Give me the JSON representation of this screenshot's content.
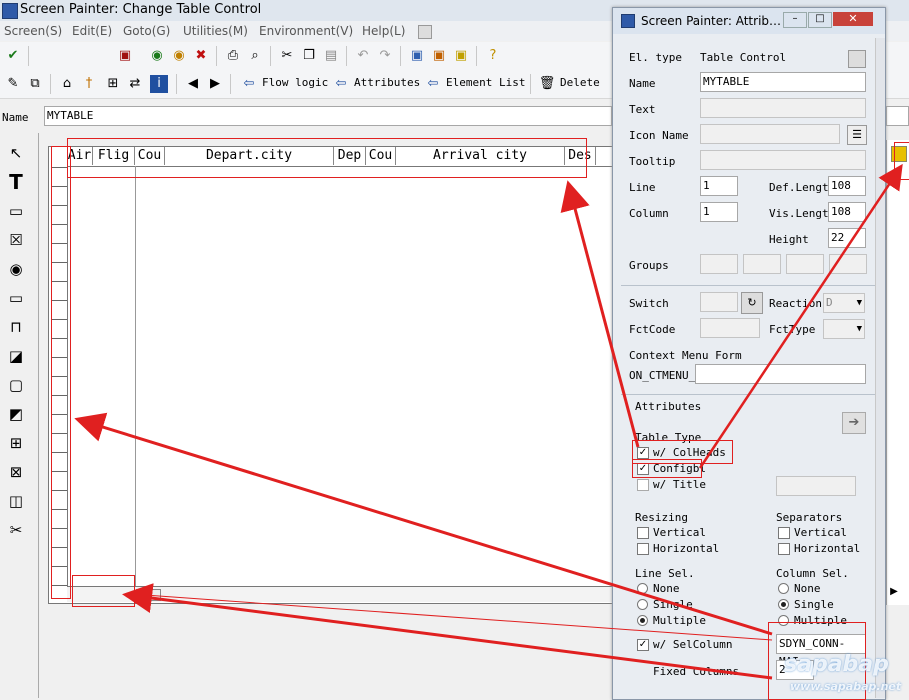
{
  "window": {
    "title": "Screen Painter: Change Table Control"
  },
  "menu": [
    "Screen(S)",
    "Edit(E)",
    "Goto(G)",
    "Utilities(M)",
    "Environment(V)",
    "Help(L)"
  ],
  "toolbar2": {
    "flow_logic": "Flow logic",
    "attributes": "Attributes",
    "element_list": "Element List",
    "delete": "Delete"
  },
  "name_row": {
    "label": "Name",
    "value": "MYTABLE"
  },
  "table": {
    "columns": [
      "Air",
      "Flig",
      "Cou",
      "Depart.city",
      "Dep",
      "Cou",
      "Arrival city",
      "Des"
    ]
  },
  "dialog": {
    "title": "Screen Painter: Attrib…",
    "el_type_label": "El. type",
    "el_type_value": "Table Control",
    "name_label": "Name",
    "name_value": "MYTABLE",
    "text_label": "Text",
    "icon_name_label": "Icon Name",
    "tooltip_label": "Tooltip",
    "line_label": "Line",
    "line_value": "1",
    "column_label": "Column",
    "column_value": "1",
    "def_length_label": "Def.Lengtl",
    "def_length_value": "108",
    "vis_length_label": "Vis.Lengtl",
    "vis_length_value": "108",
    "height_label": "Height",
    "height_value": "22",
    "groups_label": "Groups",
    "switch_label": "Switch",
    "reaction_label": "Reaction",
    "reaction_value": "D",
    "fctcode_label": "FctCode",
    "fcttype_label": "FctType",
    "context_menu_label": "Context Menu Form",
    "context_menu_prefix": "ON_CTMENU_",
    "attributes_label": "Attributes",
    "table_type_label": "Table Type",
    "w_colheads": "w/ ColHeads",
    "configbl": "Configbl",
    "w_title": "w/ Title",
    "resizing_label": "Resizing",
    "resizing_vertical": "Vertical",
    "resizing_horizontal": "Horizontal",
    "separators_label": "Separators",
    "sep_vertical": "Vertical",
    "sep_horizontal": "Horizontal",
    "line_sel_label": "Line Sel.",
    "line_none": "None",
    "line_single": "Single",
    "line_multiple": "Multiple",
    "col_sel_label": "Column Sel.",
    "col_none": "None",
    "col_single": "Single",
    "col_multiple": "Multiple",
    "w_selcolumn": "w/ SelColumn",
    "selcolumn_value": "SDYN_CONN-MAI",
    "fixed_columns_label": "Fixed Columns",
    "fixed_columns_value": "2"
  },
  "watermark": {
    "brand": "sapabap",
    "url": "www.sapabap.net"
  },
  "colors": {
    "annotation_red": "#e02020"
  }
}
